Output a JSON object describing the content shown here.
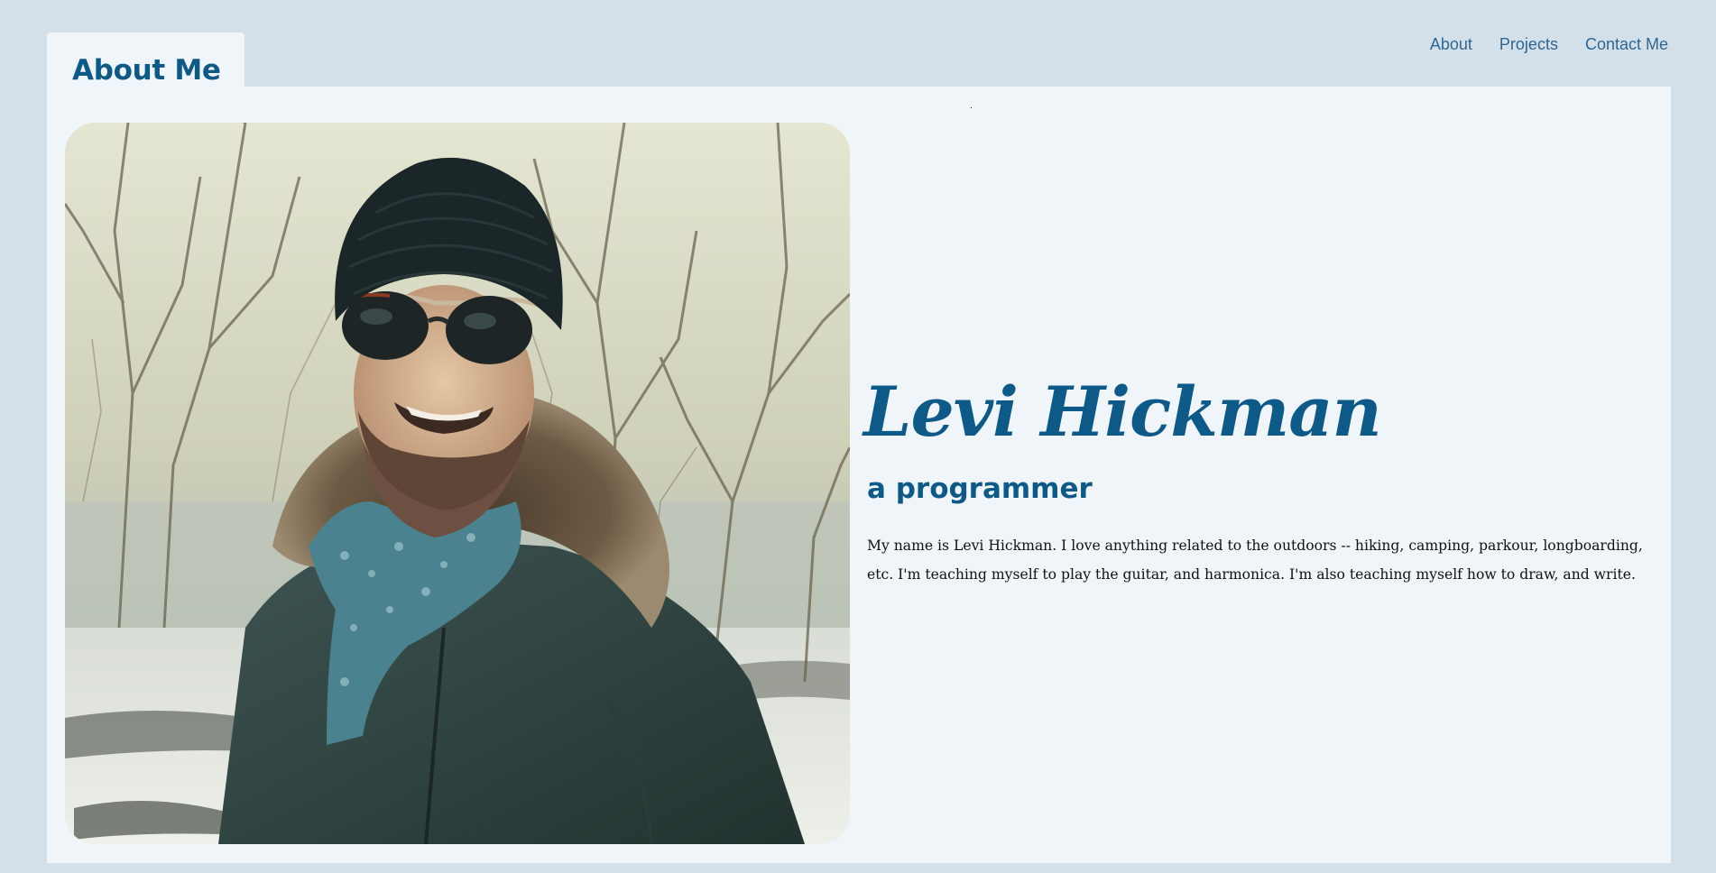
{
  "header": {
    "tab_title": "About Me"
  },
  "nav": {
    "items": [
      {
        "label": "About"
      },
      {
        "label": "Projects"
      },
      {
        "label": "Contact Me"
      }
    ]
  },
  "profile": {
    "name": "Levi Hickman",
    "role": "a programmer",
    "bio": "My name is Levi Hickman. I love anything related to the outdoors -- hiking, camping, parkour, longboarding, etc. I'm teaching myself to play the guitar, and harmonica. I'm also teaching myself how to draw, and write."
  },
  "colors": {
    "page_background": "#d3e0ea",
    "panel_background": "#f0f5f9",
    "accent": "#0d5a88",
    "nav_text": "#2f6691",
    "body_text": "#111111"
  }
}
